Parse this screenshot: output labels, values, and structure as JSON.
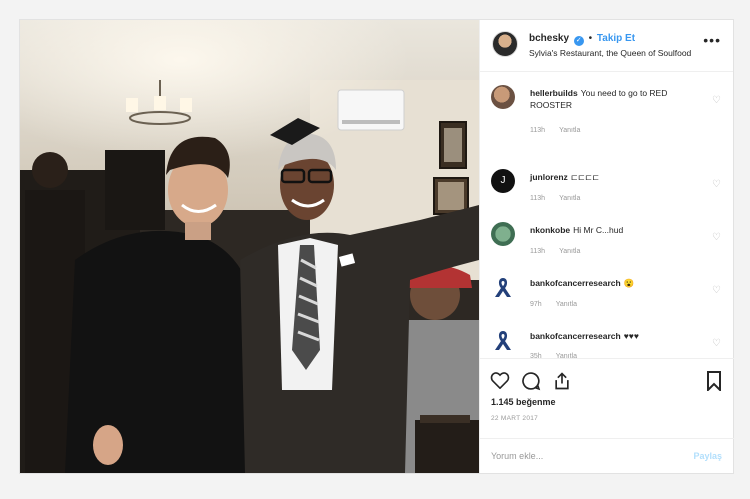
{
  "header": {
    "username": "bchesky",
    "separator": "•",
    "follow_label": "Takip Et",
    "location": "Sylvia's Restaurant, the Queen of Soulfood",
    "more_icon": "more-options-icon"
  },
  "comments": [
    {
      "user": "hellerbuilds",
      "text": "You need to go to RED ROOSTER",
      "time": "113h",
      "reply": "Yanıtla"
    },
    {
      "user": "junlorenz",
      "text": "⊏⊏⊏⊏",
      "time": "113h",
      "reply": "Yanıtla"
    },
    {
      "user": "nkonkobe",
      "text": "Hi Mr C...hud",
      "time": "113h",
      "reply": "Yanıtla"
    },
    {
      "user": "bankofcancerresearch",
      "text": "😮",
      "time": "97h",
      "reply": "Yanıtla"
    },
    {
      "user": "bankofcancerresearch",
      "text": "♥♥♥",
      "time": "35h",
      "reply": "Yanıtla"
    }
  ],
  "actions": {
    "likes": "1.145 beğenme",
    "date": "22 MART 2017"
  },
  "composer": {
    "placeholder": "Yorum ekle...",
    "post_label": "Paylaş"
  }
}
